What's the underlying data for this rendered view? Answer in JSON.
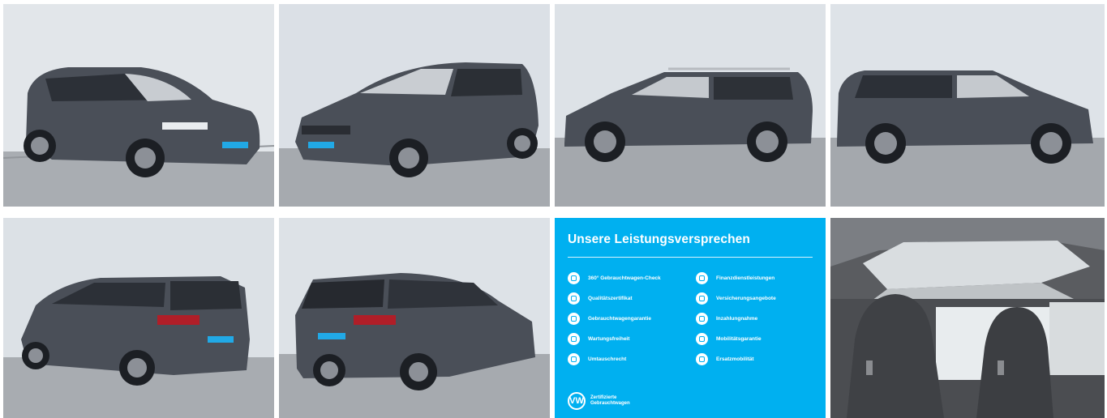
{
  "gallery": {
    "photos": [
      {
        "id": "front-left-3q",
        "kind": "exterior",
        "label": "Front three-quarter view (left)"
      },
      {
        "id": "front-right-3q",
        "kind": "exterior",
        "label": "Front three-quarter view (right)"
      },
      {
        "id": "left-side",
        "kind": "exterior",
        "label": "Left side profile"
      },
      {
        "id": "right-side",
        "kind": "exterior",
        "label": "Right side profile"
      },
      {
        "id": "rear-right-3q",
        "kind": "exterior",
        "label": "Rear three-quarter view (right)"
      },
      {
        "id": "rear-left-3q",
        "kind": "exterior",
        "label": "Rear three-quarter view (left)"
      },
      {
        "id": "interior-seats",
        "kind": "interior",
        "label": "Interior with panoramic roof"
      }
    ],
    "colors": {
      "car": "#4a4f58",
      "sky": "#dfe3e8",
      "ground": "#a7abb0",
      "accent": "#00b0f0"
    }
  },
  "promise": {
    "title": "Unsere Leistungsversprechen",
    "items_left": [
      {
        "label": "360° Gebrauchtwagen-Check",
        "icon": "check-360-icon"
      },
      {
        "label": "Qualitätszertifikat",
        "icon": "certificate-icon"
      },
      {
        "label": "Gebrauchtwagengarantie",
        "icon": "warranty-shield-icon"
      },
      {
        "label": "Wartungsfreiheit",
        "icon": "wrench-icon"
      },
      {
        "label": "Umtauschrecht",
        "icon": "exchange-icon"
      }
    ],
    "items_right": [
      {
        "label": "Finanzdienstleistungen",
        "icon": "finance-icon"
      },
      {
        "label": "Versicherungsangebote",
        "icon": "insurance-icon"
      },
      {
        "label": "Inzahlungnahme",
        "icon": "trade-in-icon"
      },
      {
        "label": "Mobilitätsgarantie",
        "icon": "mobility-icon"
      },
      {
        "label": "Ersatzmobilität",
        "icon": "replacement-car-icon"
      }
    ],
    "brand_logo": "VW",
    "brand_text": "Zertifizierte\nGebrauchtwagen"
  }
}
